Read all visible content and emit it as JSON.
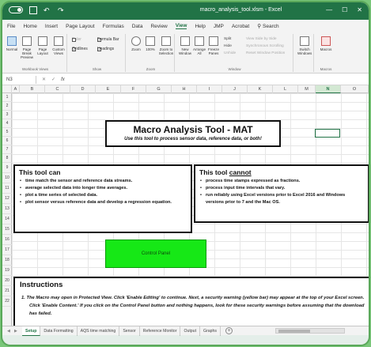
{
  "window": {
    "title": "macro_analysis_tool.xlsm - Excel"
  },
  "menu": {
    "tabs": [
      "File",
      "Home",
      "Insert",
      "Page Layout",
      "Formulas",
      "Data",
      "Review",
      "View",
      "Help",
      "JMP",
      "Acrobat"
    ],
    "active_tab": "View",
    "search_label": "Search"
  },
  "ribbon": {
    "workbook_views": {
      "normal": "Normal",
      "page_break": "Page Break Preview",
      "page_layout": "Page Layout",
      "custom": "Custom Views",
      "group": "Workbook Views"
    },
    "show": {
      "ruler": "Ruler",
      "gridlines": "Gridlines",
      "formula_bar": "Formula Bar",
      "headings": "Headings",
      "group": "Show"
    },
    "zoom": {
      "zoom": "Zoom",
      "hundred": "100%",
      "zoom_selection": "Zoom to Selection",
      "group": "Zoom"
    },
    "window": {
      "new_window": "New Window",
      "arrange_all": "Arrange All",
      "freeze_panes": "Freeze Panes",
      "split": "Split",
      "hide": "Hide",
      "unhide": "Unhide",
      "side_by_side": "View Side by Side",
      "sync_scroll": "Synchronous Scrolling",
      "reset_pos": "Reset Window Position",
      "switch": "Switch Windows",
      "group": "Window"
    },
    "macros": {
      "macros": "Macros",
      "group": "Macros"
    }
  },
  "formula_bar": {
    "name_box": "N3",
    "fx": "fx"
  },
  "grid": {
    "columns": [
      "A",
      "B",
      "C",
      "D",
      "E",
      "F",
      "G",
      "H",
      "I",
      "J",
      "K",
      "L",
      "M",
      "N",
      "O"
    ],
    "selected_column": "N",
    "rows": [
      "1",
      "2",
      "3",
      "4",
      "5",
      "6",
      "7",
      "8",
      "9",
      "10",
      "11",
      "12",
      "13",
      "14",
      "15",
      "16",
      "17",
      "18",
      "19",
      "20",
      "21",
      "22"
    ]
  },
  "sheet": {
    "title": "Macro Analysis Tool - MAT",
    "subtitle": "Use this tool to process sensor data, reference data, or both!",
    "can": {
      "heading": "This tool can",
      "items": [
        "time match the sensor and reference data streams.",
        "average selected data into longer time averages.",
        "plot a time series of selected data.",
        "plot sensor versus reference data and develop a regression equation."
      ]
    },
    "cannot": {
      "heading_prefix": "This tool ",
      "heading_emph": "cannot",
      "items": [
        "process time stamps expressed as fractions.",
        "process input time intervals that vary.",
        "run reliably using Excel versions prior to Excel 2016 and Windows versions prior to 7 and the Mac OS."
      ]
    },
    "control_panel_label": "Control Panel",
    "instructions": {
      "heading": "Instructions",
      "item1": "1.   The Macro may open in Protected View.  Click 'Enable Editing' to continue. Next, a security warning (yellow bar) may appear at the top of your Excel screen.  Click 'Enable Content.'  If you click on the Control Panel button and nothing happens, look for these security warnings before assuming that the download has failed."
    }
  },
  "sheet_tabs": [
    "Setup",
    "Data Formatting",
    "AQS time matching",
    "Sensor",
    "Reference Monitor",
    "Output",
    "Graphs"
  ],
  "active_sheet": "Setup",
  "colors": {
    "excel_green": "#217346",
    "control_button": "#16e816",
    "outer_frame": "#7ac77a"
  }
}
